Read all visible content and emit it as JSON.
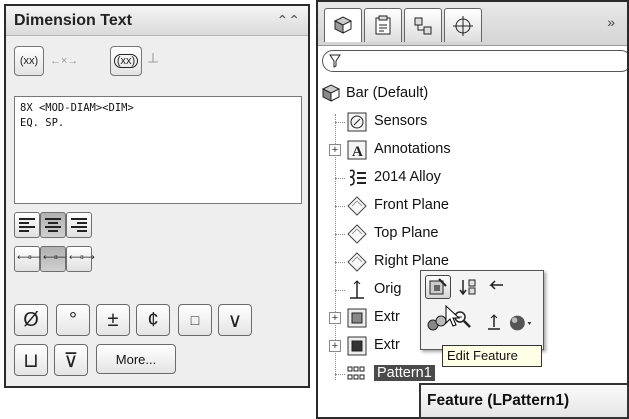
{
  "dimension_text": {
    "title": "Dimension Text",
    "collapse_icon": "double-chevron-up-icon",
    "text_lines": [
      "8X <MOD-DIAM><DIM>",
      "EQ. SP."
    ],
    "buttons": {
      "add_parentheses": "(xx)",
      "inspection": "(xx)",
      "more": "More..."
    },
    "justify": [
      "justify-left",
      "justify-center",
      "justify-right"
    ],
    "symbols": [
      "Ø",
      "°",
      "±",
      "¢",
      "□",
      "∨"
    ],
    "bottom_symbols": [
      "⊔",
      "⊽"
    ]
  },
  "feature_manager": {
    "tabs": [
      "feature-manager-tab",
      "property-manager-tab",
      "configuration-manager-tab",
      "dimxpert-tab"
    ],
    "overflow": "»",
    "filter_icon": "funnel-icon",
    "tree": [
      {
        "label": "Bar  (Default)",
        "icon": "part-icon",
        "expandable": false
      },
      {
        "label": "Sensors",
        "icon": "sensors-icon",
        "expandable": false
      },
      {
        "label": "Annotations",
        "icon": "annotations-icon",
        "expandable": true
      },
      {
        "label": "2014 Alloy",
        "icon": "material-icon",
        "expandable": false
      },
      {
        "label": "Front Plane",
        "icon": "plane-icon",
        "expandable": false
      },
      {
        "label": "Top Plane",
        "icon": "plane-icon",
        "expandable": false
      },
      {
        "label": "Right Plane",
        "icon": "plane-icon",
        "expandable": false
      },
      {
        "label": "Orig",
        "icon": "origin-icon",
        "expandable": false
      },
      {
        "label": "Extr",
        "icon": "extrude-icon",
        "expandable": true
      },
      {
        "label": "Extr",
        "icon": "extrude-icon",
        "expandable": true
      },
      {
        "label": "Pattern1",
        "icon": "pattern-icon",
        "expandable": false
      }
    ],
    "context_toolbar": {
      "tooltip": "Edit Feature",
      "buttons": [
        "edit-feature-icon",
        "rollback-icon",
        "hide-icon",
        "appearance-icon",
        "zoom-to-selection-icon",
        "normal-to-icon"
      ]
    },
    "feature_tooltip": "Feature (LPattern1)"
  }
}
